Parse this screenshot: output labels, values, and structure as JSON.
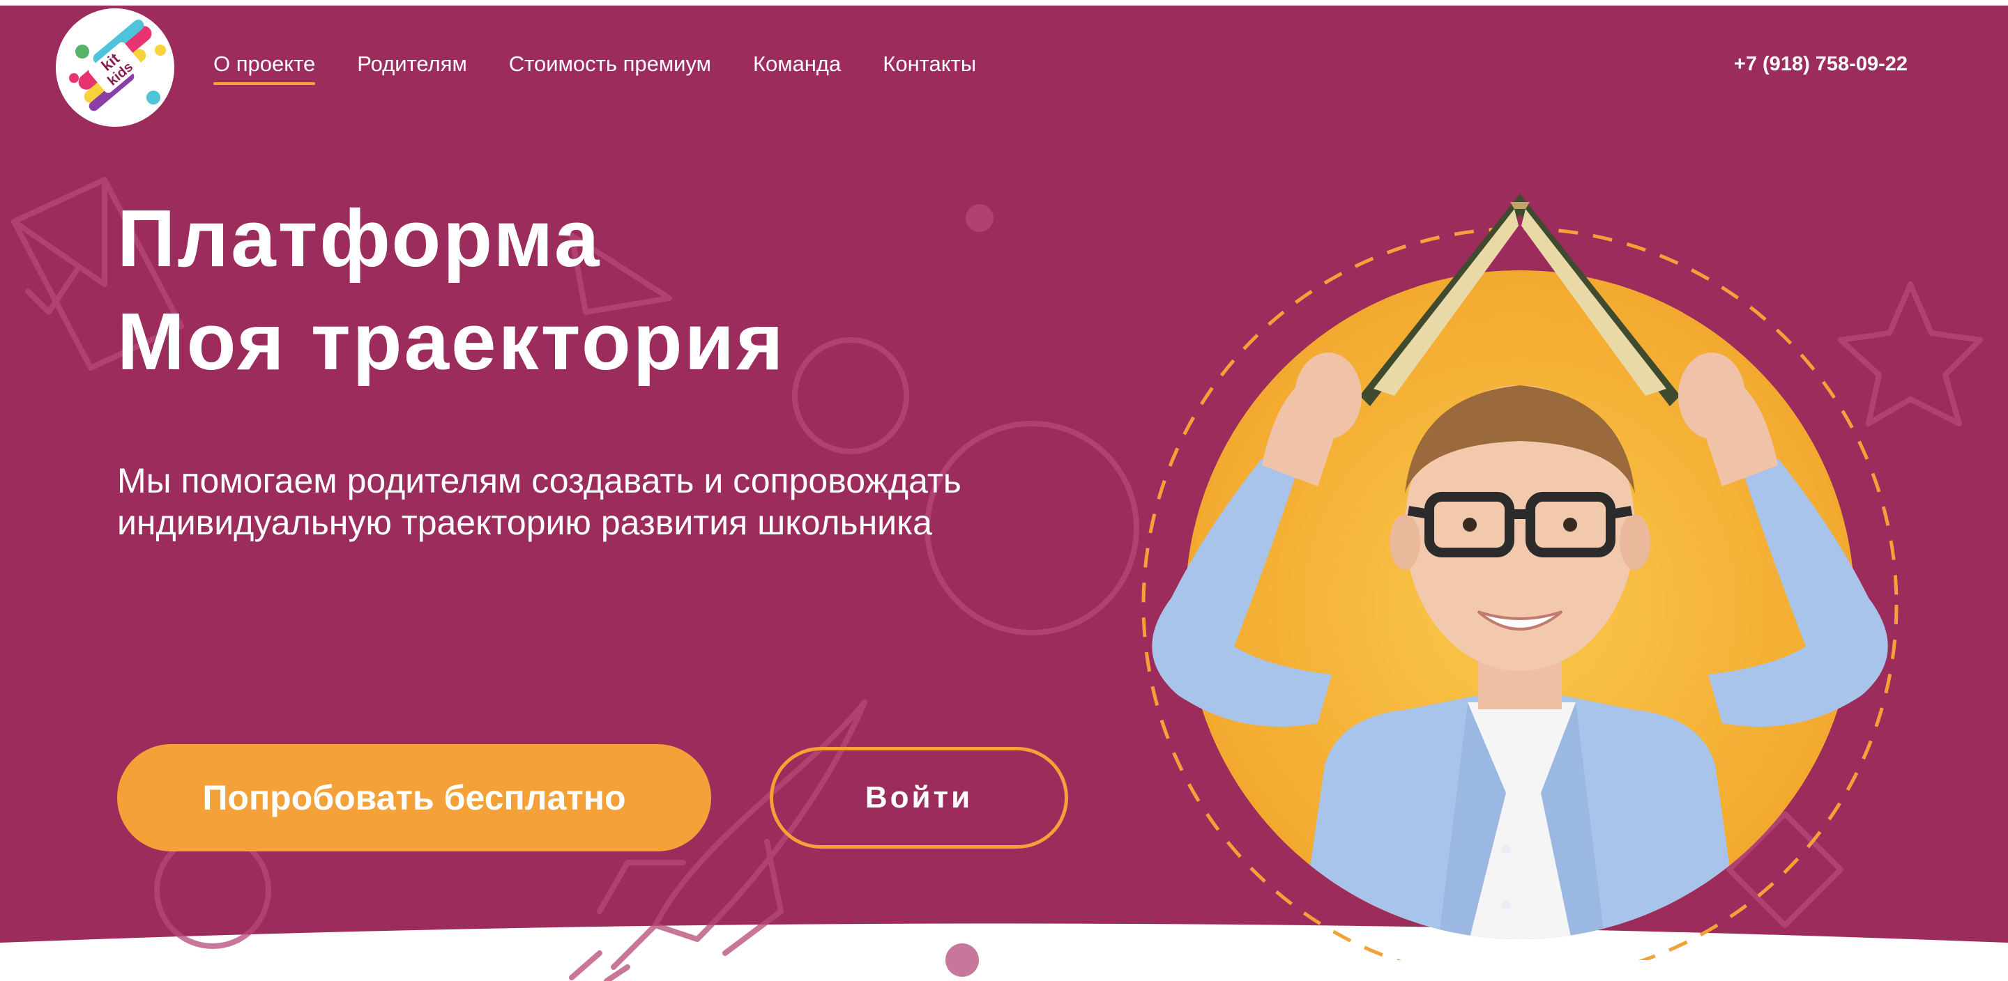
{
  "colors": {
    "background": "#9b2c5c",
    "accent": "#f4a13a",
    "text": "#ffffff",
    "photo_circle": "#f6b93b"
  },
  "logo": {
    "text_top": "kit",
    "text_bottom": "kids",
    "icon": "kit-kids-logo"
  },
  "nav": {
    "items": [
      {
        "label": "О проекте",
        "active": true
      },
      {
        "label": "Родителям",
        "active": false
      },
      {
        "label": "Стоимость премиум",
        "active": false
      },
      {
        "label": "Команда",
        "active": false
      },
      {
        "label": "Контакты",
        "active": false
      }
    ]
  },
  "header": {
    "phone": "+7 (918) 758-09-22"
  },
  "hero": {
    "title_line1": "Платформа",
    "title_line2": "Моя траектория",
    "subtitle_line1": "Мы помогаем родителям создавать и сопровождать",
    "subtitle_line2": "индивидуальную траекторию развития школьника",
    "primary_button": "Попробовать бесплатно",
    "secondary_button": "Войти",
    "photo": "boy-with-book-on-head-photo"
  }
}
